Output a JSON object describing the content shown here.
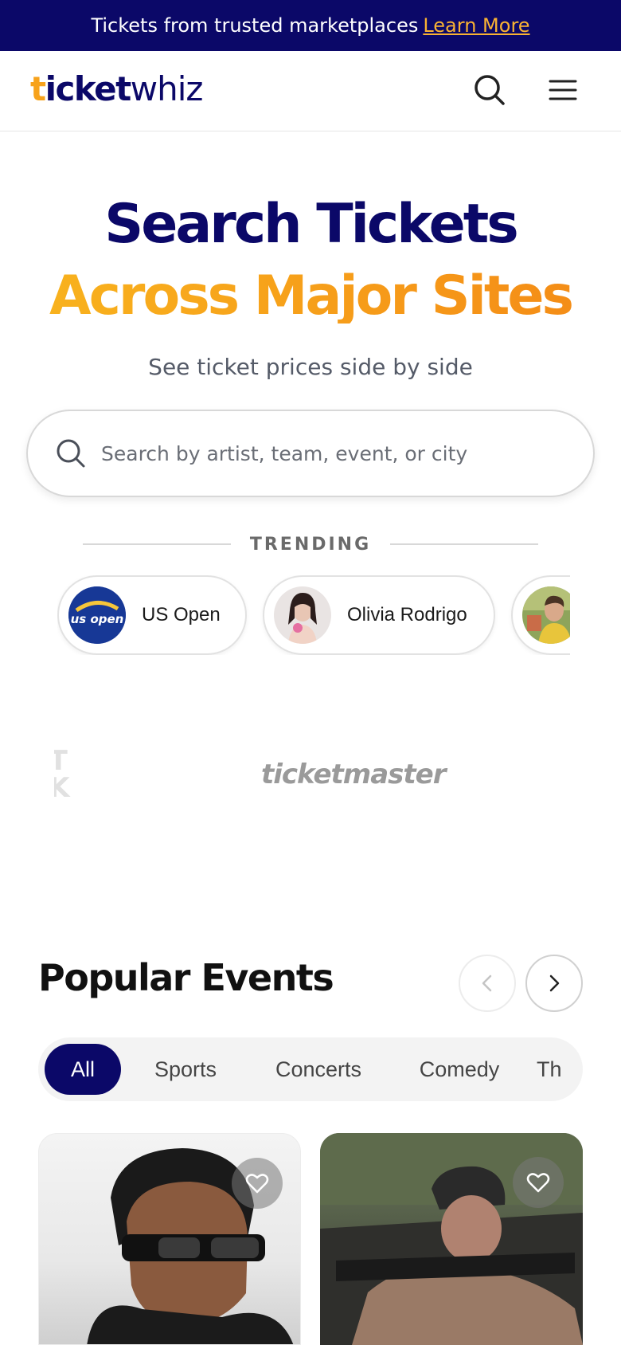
{
  "promo": {
    "text": "Tickets from trusted marketplaces",
    "link_label": "Learn More"
  },
  "header": {
    "logo": {
      "part1": "t",
      "part2": "icket",
      "part3": "whiz"
    },
    "icons": {
      "search": "search-icon",
      "menu": "hamburger-menu-icon"
    }
  },
  "hero": {
    "title_line1": "Search Tickets",
    "title_line2": "Across Major Sites",
    "subtitle": "See ticket prices side by side"
  },
  "search": {
    "placeholder": "Search by artist, team, event, or city"
  },
  "trending": {
    "label": "TRENDING",
    "items": [
      {
        "label": "US Open",
        "avatar_text": "us open"
      },
      {
        "label": "Olivia Rodrigo"
      },
      {
        "label": ""
      }
    ]
  },
  "partners": {
    "left_partial_line1": "AT",
    "left_partial_line2": "EK",
    "ticketmaster": "ticketmaster"
  },
  "popular": {
    "title": "Popular Events",
    "filters": [
      "All",
      "Sports",
      "Concerts",
      "Comedy",
      "Th"
    ],
    "active_filter": "All"
  },
  "colors": {
    "navy": "#0b0868",
    "orange": "#f7a21b",
    "link": "#f9b233"
  }
}
